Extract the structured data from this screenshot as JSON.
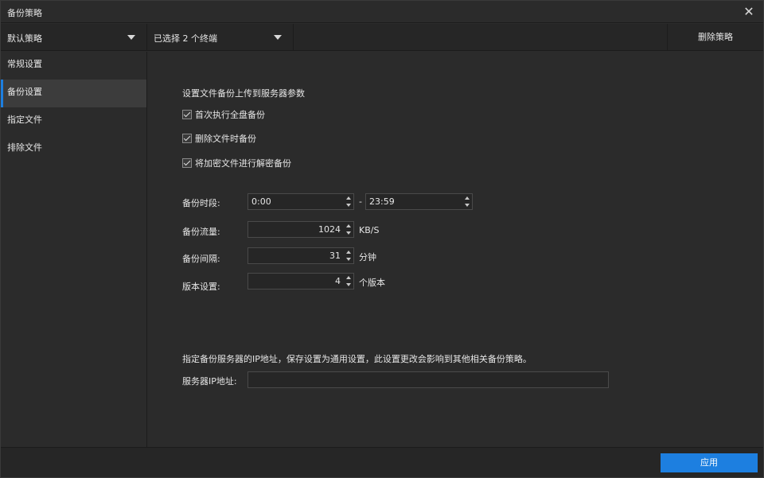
{
  "window": {
    "title": "备份策略"
  },
  "toolbar": {
    "policy_select": "默认策略",
    "terminal_select": "已选择 2 个终端",
    "delete_label": "删除策略"
  },
  "sidebar": {
    "items": [
      {
        "label": "常规设置",
        "active": false
      },
      {
        "label": "备份设置",
        "active": true
      },
      {
        "label": "指定文件",
        "active": false
      },
      {
        "label": "排除文件",
        "active": false
      }
    ]
  },
  "main": {
    "section_title": "设置文件备份上传到服务器参数",
    "checkboxes": [
      {
        "label": "首次执行全盘备份",
        "checked": true
      },
      {
        "label": "删除文件时备份",
        "checked": true
      },
      {
        "label": "将加密文件进行解密备份",
        "checked": true
      }
    ],
    "period": {
      "label": "备份时段:",
      "start": "0:00",
      "separator": "-",
      "end": "23:59"
    },
    "traffic": {
      "label": "备份流量:",
      "value": "1024",
      "unit": "KB/S"
    },
    "interval": {
      "label": "备份间隔:",
      "value": "31",
      "unit": "分钟"
    },
    "versions": {
      "label": "版本设置:",
      "value": "4",
      "unit": "个版本"
    },
    "ip_note": "指定备份服务器的IP地址，保存设置为通用设置，此设置更改会影响到其他相关备份策略。",
    "ip_label": "服务器IP地址:",
    "ip_value": ""
  },
  "footer": {
    "apply_label": "应用"
  },
  "colors": {
    "accent": "#1d7fe0",
    "background": "#2b2b2b"
  },
  "icons": {
    "close": "close-icon",
    "dropdown": "chevron-down-icon",
    "check": "check-icon"
  }
}
